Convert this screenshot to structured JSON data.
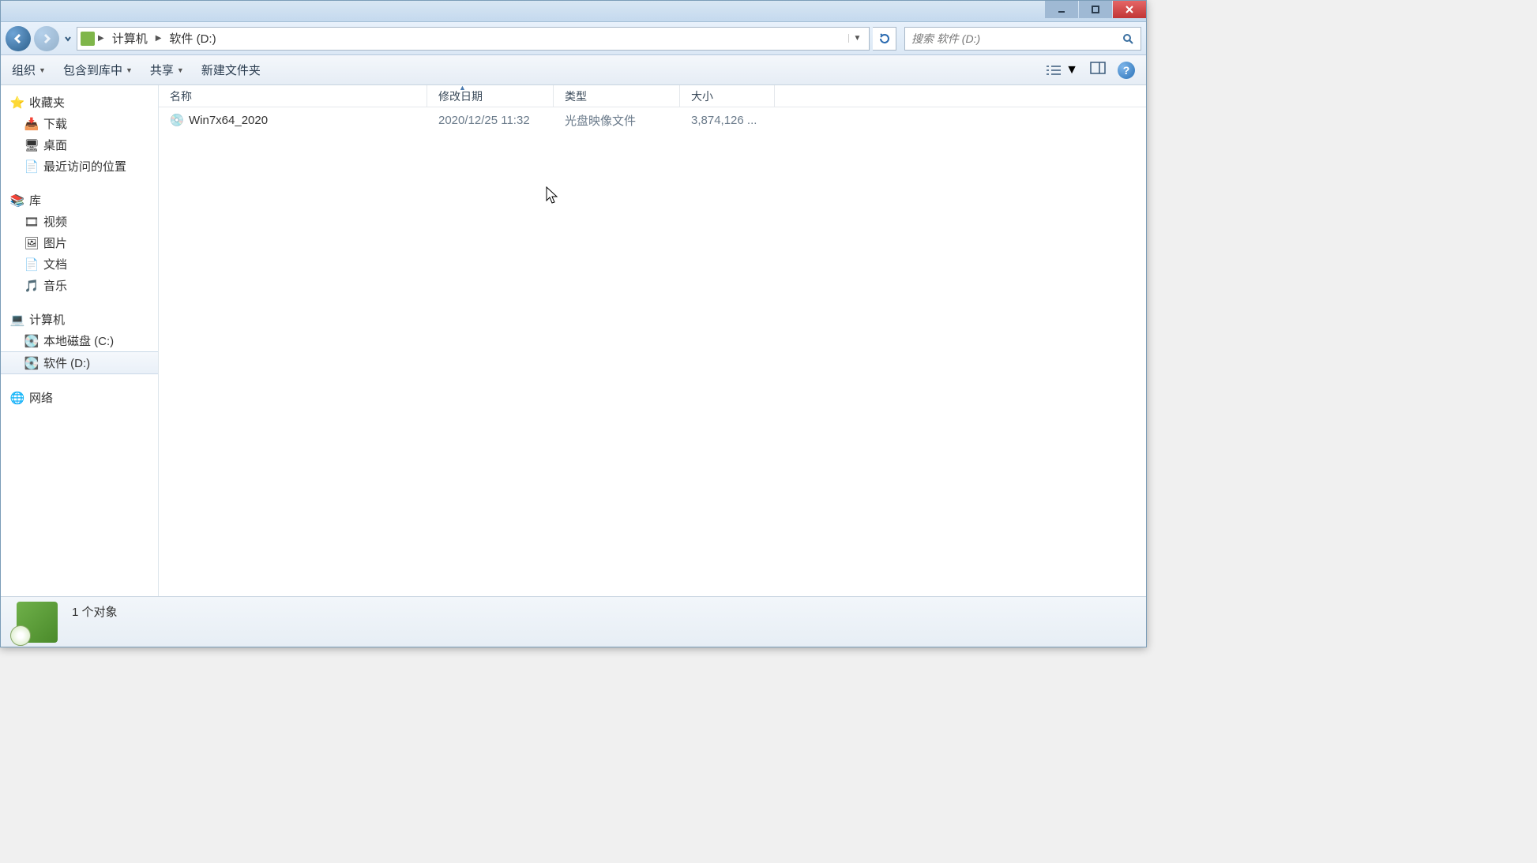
{
  "address": {
    "crumbs": [
      "计算机",
      "软件 (D:)"
    ]
  },
  "search": {
    "placeholder": "搜索 软件 (D:)"
  },
  "toolbar": {
    "organize": "组织",
    "include": "包含到库中",
    "share": "共享",
    "newfolder": "新建文件夹"
  },
  "sidebar": {
    "favorites": {
      "label": "收藏夹",
      "items": [
        {
          "label": "下载"
        },
        {
          "label": "桌面"
        },
        {
          "label": "最近访问的位置"
        }
      ]
    },
    "libraries": {
      "label": "库",
      "items": [
        {
          "label": "视频"
        },
        {
          "label": "图片"
        },
        {
          "label": "文档"
        },
        {
          "label": "音乐"
        }
      ]
    },
    "computer": {
      "label": "计算机",
      "items": [
        {
          "label": "本地磁盘 (C:)"
        },
        {
          "label": "软件 (D:)",
          "selected": true
        }
      ]
    },
    "network": {
      "label": "网络"
    }
  },
  "columns": {
    "name": "名称",
    "date": "修改日期",
    "type": "类型",
    "size": "大小"
  },
  "files": [
    {
      "name": "Win7x64_2020",
      "date": "2020/12/25 11:32",
      "type": "光盘映像文件",
      "size": "3,874,126 ..."
    }
  ],
  "status": {
    "count": "1 个对象"
  },
  "help_glyph": "?"
}
